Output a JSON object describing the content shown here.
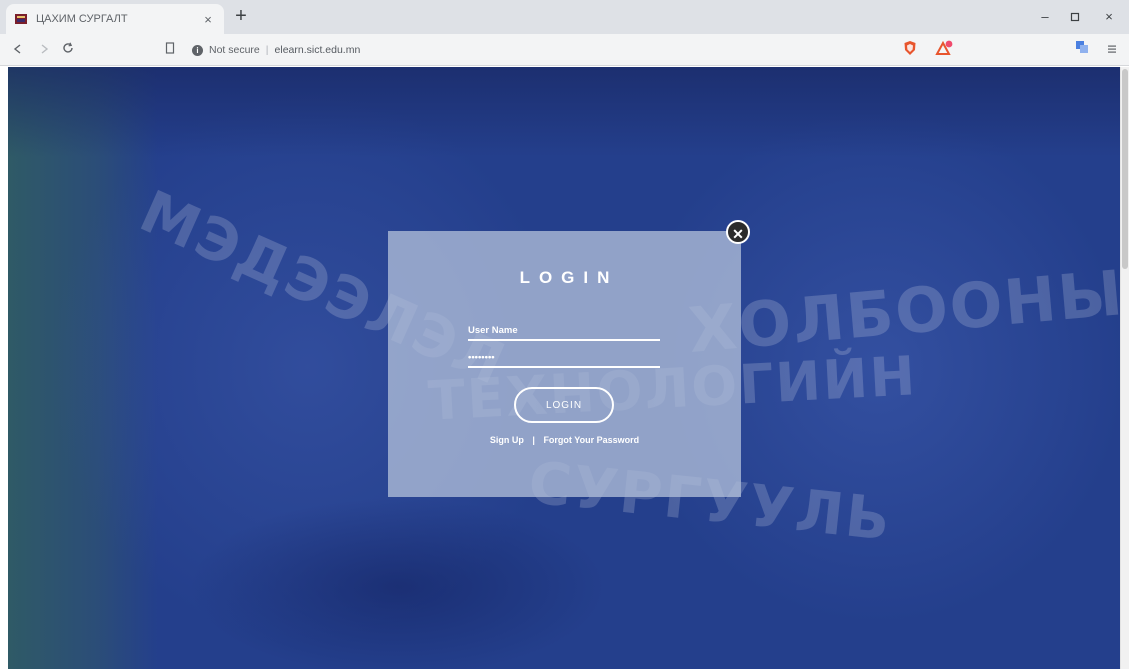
{
  "browser": {
    "tab": {
      "title": "ЦАХИМ СУРГАЛТ",
      "close_glyph": "×",
      "favicon": "university-logo-icon"
    },
    "new_tab_glyph": "+",
    "window_controls": {
      "minimize": "–",
      "maximize": "▫",
      "close": "×"
    },
    "nav": {
      "back": "◁",
      "forward": "▷",
      "reload": "C",
      "bookmark": "🔖"
    },
    "address": {
      "security": "Not secure",
      "separator": "|",
      "url": "elearn.sict.edu.mn"
    },
    "extension_icons": [
      "brave-shield-icon",
      "brave-rewards-icon",
      "translate-icon",
      "menu-icon"
    ]
  },
  "background_text": {
    "line1": "МЭДЭЭЛЭЛ",
    "line2": "ХОЛБООНЫ",
    "line3": "ТЕХНОЛОГИЙН",
    "line4": "СУРГУУЛЬ"
  },
  "login": {
    "title": "LOGIN",
    "username_placeholder": "User Name",
    "password_value": "••••••••",
    "button_label": "LOGIN",
    "signup_link": "Sign Up",
    "link_separator": "|",
    "forgot_link": "Forgot Your Password",
    "close_glyph": "✕"
  },
  "colors": {
    "page_overlay": "#243f8c",
    "modal_bg": "#b0bed8",
    "accent_shield": "#e8552d"
  }
}
